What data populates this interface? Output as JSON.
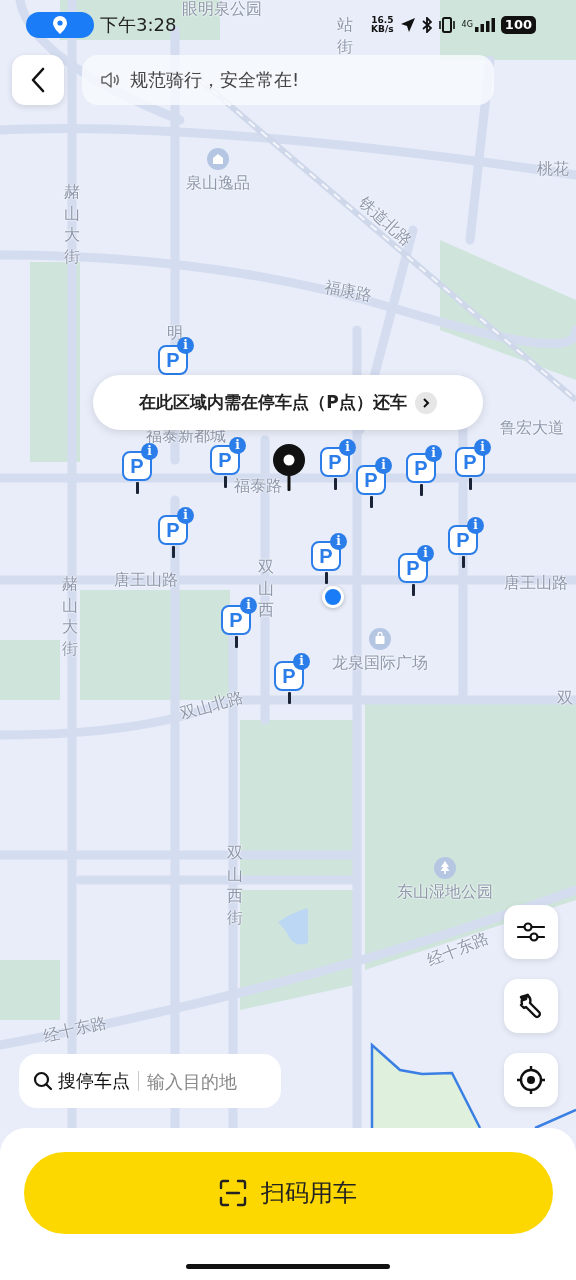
{
  "status_bar": {
    "time": "下午3:28",
    "speed_value": "16.5",
    "speed_unit": "KB/s",
    "network": "4G",
    "battery": "100"
  },
  "notice": {
    "text": "规范骑行，安全常在!"
  },
  "map": {
    "labels": [
      {
        "text": "眼明泉公园",
        "kind": "horizontal"
      },
      {
        "text": "站街",
        "kind": "vertical"
      },
      {
        "text": "泉山逸品",
        "kind": "horizontal"
      },
      {
        "text": "桃花",
        "kind": "horizontal"
      },
      {
        "text": "赭山大街",
        "kind": "vertical"
      },
      {
        "text": "铁道北路",
        "kind": "rotated"
      },
      {
        "text": "福康路",
        "kind": "rotated"
      },
      {
        "text": "明",
        "kind": "horizontal"
      },
      {
        "text": "福泰新都城",
        "kind": "horizontal"
      },
      {
        "text": "福泰路",
        "kind": "horizontal"
      },
      {
        "text": "鲁宏大道",
        "kind": "horizontal"
      },
      {
        "text": "赭山大街",
        "kind": "vertical"
      },
      {
        "text": "唐王山路",
        "kind": "horizontal"
      },
      {
        "text": "双山西",
        "kind": "vertical"
      },
      {
        "text": "唐王山路",
        "kind": "horizontal"
      },
      {
        "text": "龙泉国际广场",
        "kind": "horizontal"
      },
      {
        "text": "双山北路",
        "kind": "rotated"
      },
      {
        "text": "双",
        "kind": "horizontal"
      },
      {
        "text": "双山西街",
        "kind": "vertical"
      },
      {
        "text": "东山湿地公园",
        "kind": "horizontal"
      },
      {
        "text": "经十东路",
        "kind": "rotated"
      },
      {
        "text": "经十东路",
        "kind": "rotated"
      }
    ],
    "parking_points": [
      {
        "letter": "P",
        "badge": "i"
      },
      {
        "letter": "P",
        "badge": "i"
      },
      {
        "letter": "P",
        "badge": "i"
      },
      {
        "letter": "P",
        "badge": "i"
      },
      {
        "letter": "P",
        "badge": "i"
      },
      {
        "letter": "P",
        "badge": "i"
      },
      {
        "letter": "P",
        "badge": "i"
      },
      {
        "letter": "P",
        "badge": "i"
      },
      {
        "letter": "P",
        "badge": "i"
      },
      {
        "letter": "P",
        "badge": "i"
      },
      {
        "letter": "P",
        "badge": "i"
      },
      {
        "letter": "P",
        "badge": "i"
      },
      {
        "letter": "P",
        "badge": "i"
      }
    ],
    "tooltip": {
      "text": "在此区域内需在停车点（P点）还车"
    }
  },
  "search": {
    "label": "搜停车点",
    "placeholder": "输入目的地"
  },
  "scan_button": {
    "label": "扫码用车"
  }
}
